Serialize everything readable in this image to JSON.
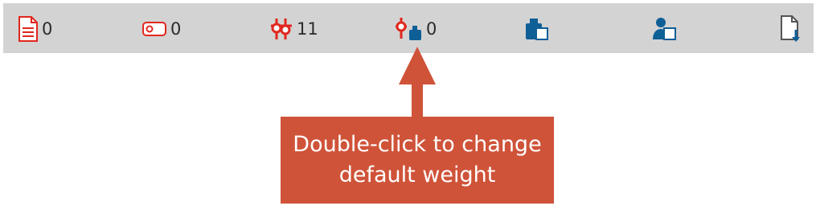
{
  "statusbar": {
    "items": [
      {
        "icon": "document-icon",
        "count": "0"
      },
      {
        "icon": "tag-icon",
        "count": "0"
      },
      {
        "icon": "breakpoint-icon",
        "count": "11"
      },
      {
        "icon": "breakpoint-weight-icon",
        "count": "0"
      },
      {
        "icon": "weight-export-icon"
      },
      {
        "icon": "user-export-icon"
      },
      {
        "icon": "file-download-icon"
      }
    ]
  },
  "callout": {
    "line1": "Double-click to change",
    "line2": "default weight"
  },
  "colors": {
    "statusbar_bg": "#d3d3d3",
    "alert_red": "#e1271e",
    "accent_blue": "#0f5f97",
    "callout_bg": "#cf5339"
  }
}
